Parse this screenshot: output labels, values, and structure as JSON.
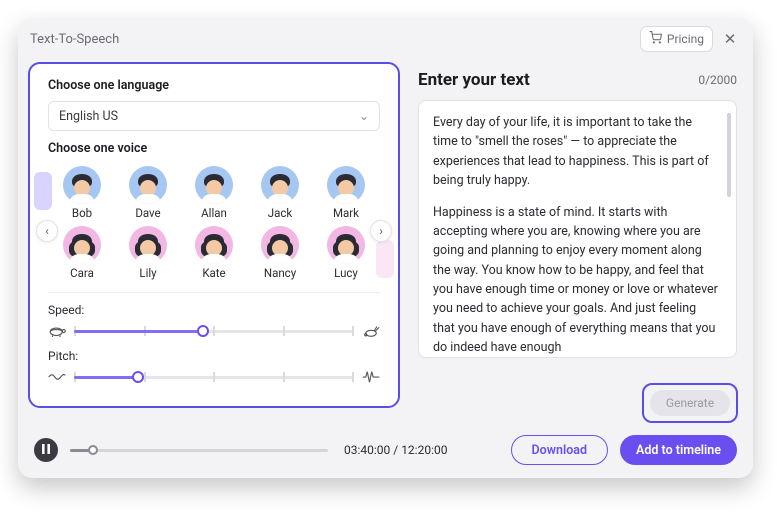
{
  "titlebar": {
    "title": "Text-To-Speech",
    "pricing": "Pricing"
  },
  "left": {
    "lang_label": "Choose one language",
    "lang_value": "English US",
    "voice_label": "Choose one voice",
    "voices_row1": [
      {
        "name": "Bob"
      },
      {
        "name": "Dave"
      },
      {
        "name": "Allan"
      },
      {
        "name": "Jack"
      },
      {
        "name": "Mark"
      }
    ],
    "voices_row2": [
      {
        "name": "Cara"
      },
      {
        "name": "Lily"
      },
      {
        "name": "Kate"
      },
      {
        "name": "Nancy"
      },
      {
        "name": "Lucy"
      }
    ],
    "speed": {
      "label": "Speed:",
      "value_pct": 46,
      "ticks": 5
    },
    "pitch": {
      "label": "Pitch:",
      "value_pct": 23,
      "ticks": 5
    }
  },
  "right": {
    "title": "Enter your text",
    "counter": "0/2000",
    "para1": "Every day of your life, it is important to take the time to \"smell the roses\" — to appreciate the experiences that lead to happiness. This is part of being truly happy.",
    "para2": "Happiness is a state of mind. It starts with accepting where you are, knowing where you are going and planning to enjoy every moment along the way. You know how to be happy, and feel that you have enough time or money or love or whatever you need to achieve your goals. And just feeling that you have enough of everything means that you do indeed have enough",
    "generate": "Generate"
  },
  "player": {
    "elapsed": "03:40:00",
    "total": "12:20:00",
    "progress_pct": 9,
    "download": "Download",
    "add": "Add to timeline"
  }
}
